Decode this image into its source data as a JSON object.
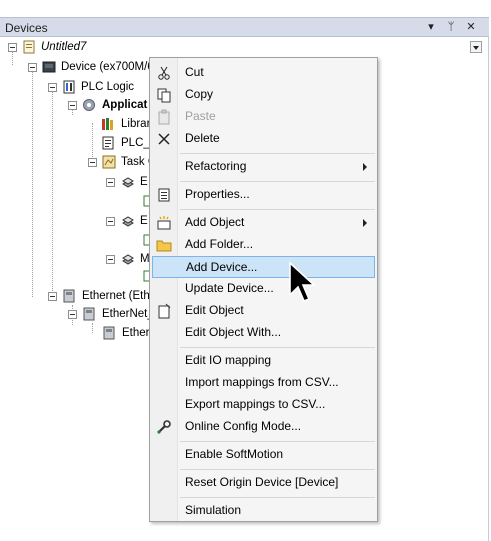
{
  "panel": {
    "title": "Devices",
    "buttons": [
      "▾",
      "ᛘ",
      "✕"
    ]
  },
  "tree": {
    "items": [
      {
        "label": "Untitled7"
      },
      {
        "label": "Device (ex700M/6"
      },
      {
        "label": "PLC Logic"
      },
      {
        "label": "Applicat"
      },
      {
        "label": "Librar"
      },
      {
        "label": "PLC_F"
      },
      {
        "label": "Task C"
      },
      {
        "label": "E"
      },
      {
        "label": "E"
      },
      {
        "label": "M"
      },
      {
        "label": "Ethernet (Ethe"
      },
      {
        "label": "EtherNet_"
      },
      {
        "label": "Ether"
      }
    ]
  },
  "context_menu": {
    "items": [
      {
        "label": "Cut",
        "icon": "scissors-icon"
      },
      {
        "label": "Copy",
        "icon": "copy-icon"
      },
      {
        "label": "Paste",
        "icon": "paste-icon",
        "disabled": true
      },
      {
        "label": "Delete",
        "icon": "delete-icon"
      },
      {
        "label": "Refactoring",
        "submenu": true
      },
      {
        "label": "Properties...",
        "icon": "properties-icon"
      },
      {
        "label": "Add Object",
        "icon": "add-object-icon",
        "submenu": true
      },
      {
        "label": "Add Folder...",
        "icon": "folder-icon"
      },
      {
        "label": "Add Device...",
        "highlighted": true
      },
      {
        "label": "Update Device..."
      },
      {
        "label": "Edit Object",
        "icon": "edit-object-icon"
      },
      {
        "label": "Edit Object With..."
      },
      {
        "label": "Edit IO mapping"
      },
      {
        "label": "Import mappings from CSV..."
      },
      {
        "label": "Export mappings to CSV..."
      },
      {
        "label": "Online Config Mode...",
        "icon": "wrench-icon"
      },
      {
        "label": "Enable SoftMotion"
      },
      {
        "label": "Reset Origin Device [Device]"
      },
      {
        "label": "Simulation"
      }
    ]
  },
  "colors": {
    "highlight": "#cce4f7",
    "highlight_border": "#7eb4ea",
    "header_bg": "#d6dbe9",
    "menu_bg": "#f5f5f5"
  }
}
